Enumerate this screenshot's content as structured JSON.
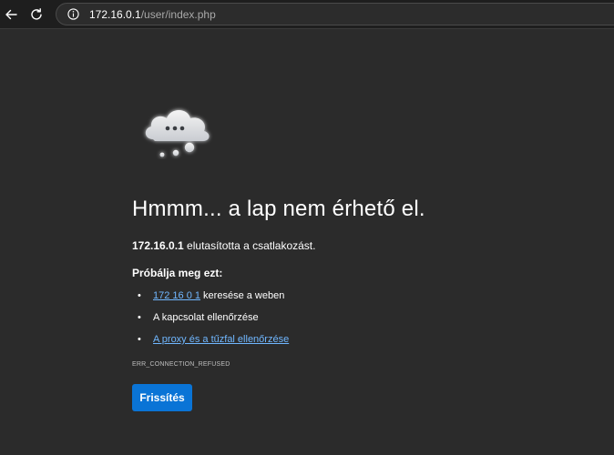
{
  "browser": {
    "url_host": "172.16.0.1",
    "url_path": "/user/index.php"
  },
  "error": {
    "title": "Hmmm... a lap nem érhető el.",
    "host": "172.16.0.1",
    "refused_text": " elutasította a csatlakozást.",
    "try_heading": "Próbálja meg ezt:",
    "suggestions": {
      "search_link": "172 16 0 1",
      "search_suffix": " keresése a weben",
      "check_connection": "A kapcsolat ellenőrzése",
      "check_proxy_link": "A proxy és a tűzfal ellenőrzése"
    },
    "error_code": "ERR_CONNECTION_REFUSED",
    "refresh_label": "Frissítés"
  },
  "icons": {
    "back": "arrow-left-icon",
    "reload": "reload-icon",
    "site_info": "info-circle-icon",
    "error_illustration": "cloud-icon"
  },
  "colors": {
    "background": "#2b2b2b",
    "link": "#70b7ff",
    "button": "#0a74d6"
  }
}
